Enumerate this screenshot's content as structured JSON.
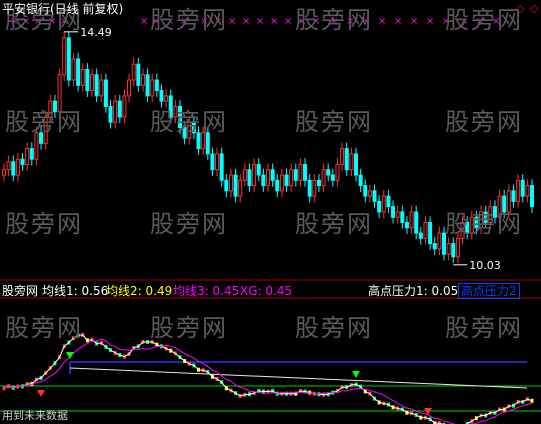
{
  "watermark": {
    "text": "股旁网"
  },
  "title": "平安银行(日线 前复权)",
  "top_marks": {
    "x_glyph": "×",
    "right_glyph": "◇",
    "colors": {
      "x": "#ff00ff",
      "diamond": "#ff0000"
    }
  },
  "indicators": [
    {
      "key": "name",
      "text": "股旁网",
      "color": "#ffffff"
    },
    {
      "key": "ma1",
      "text": "均线1: 0.56",
      "color": "#ffffff"
    },
    {
      "key": "ma2",
      "text": "均线2: 0.49",
      "color": "#ffff00"
    },
    {
      "key": "ma3",
      "text": "均线3: 0.45",
      "color": "#ff00ff"
    },
    {
      "key": "xg",
      "text": "XG: 0.45",
      "color": "#ff00ff"
    }
  ],
  "pressure": {
    "label": "高点压力1: 0.05",
    "label_color": "#ffffff",
    "tag": "高点压力2",
    "tag_color": "#0044ff"
  },
  "footer": "用到未来数据",
  "colors": {
    "up": "#ff3030",
    "down": "#00ffff",
    "divider": "#b00000",
    "blue_line": "#3030ff",
    "green_line": "#00cc00",
    "white_line": "#e8e8e8"
  },
  "chart_data": {
    "type": "candlestick",
    "annotations": [
      {
        "text": "14.49",
        "kind": "high"
      },
      {
        "text": "10.03",
        "kind": "low"
      }
    ],
    "close_path": [
      11.8,
      11.95,
      11.7,
      12.0,
      11.9,
      12.2,
      12.0,
      12.5,
      12.3,
      12.8,
      13.1,
      12.9,
      13.6,
      14.3,
      13.5,
      13.9,
      13.4,
      13.7,
      13.3,
      13.6,
      13.2,
      13.5,
      13.0,
      12.7,
      13.1,
      12.8,
      13.2,
      13.5,
      13.8,
      13.4,
      13.6,
      13.2,
      13.5,
      13.3,
      13.1,
      13.2,
      12.8,
      13.0,
      12.6,
      12.4,
      12.7,
      12.5,
      12.2,
      12.5,
      12.1,
      11.8,
      12.1,
      11.6,
      11.4,
      11.7,
      11.3,
      11.6,
      11.8,
      11.5,
      11.9,
      11.7,
      11.5,
      11.8,
      11.6,
      11.4,
      11.7,
      11.5,
      11.8,
      11.6,
      11.9,
      11.6,
      11.3,
      11.6,
      11.5,
      11.8,
      11.7,
      11.6,
      11.9,
      12.2,
      11.8,
      12.1,
      11.7,
      11.5,
      11.3,
      11.4,
      11.2,
      11.0,
      11.3,
      11.1,
      10.9,
      11.0,
      10.8,
      10.7,
      11.0,
      10.6,
      10.5,
      10.8,
      10.4,
      10.3,
      10.6,
      10.2,
      10.4,
      10.15,
      10.5,
      10.8,
      10.6,
      10.9,
      10.7,
      11.0,
      10.8,
      11.1,
      10.9,
      11.3,
      11.0,
      11.4,
      11.2,
      11.6,
      11.3,
      11.5,
      11.1
    ],
    "lower_panel": {
      "lines": [
        "ma1",
        "ma2",
        "ma3",
        "XG"
      ]
    }
  }
}
